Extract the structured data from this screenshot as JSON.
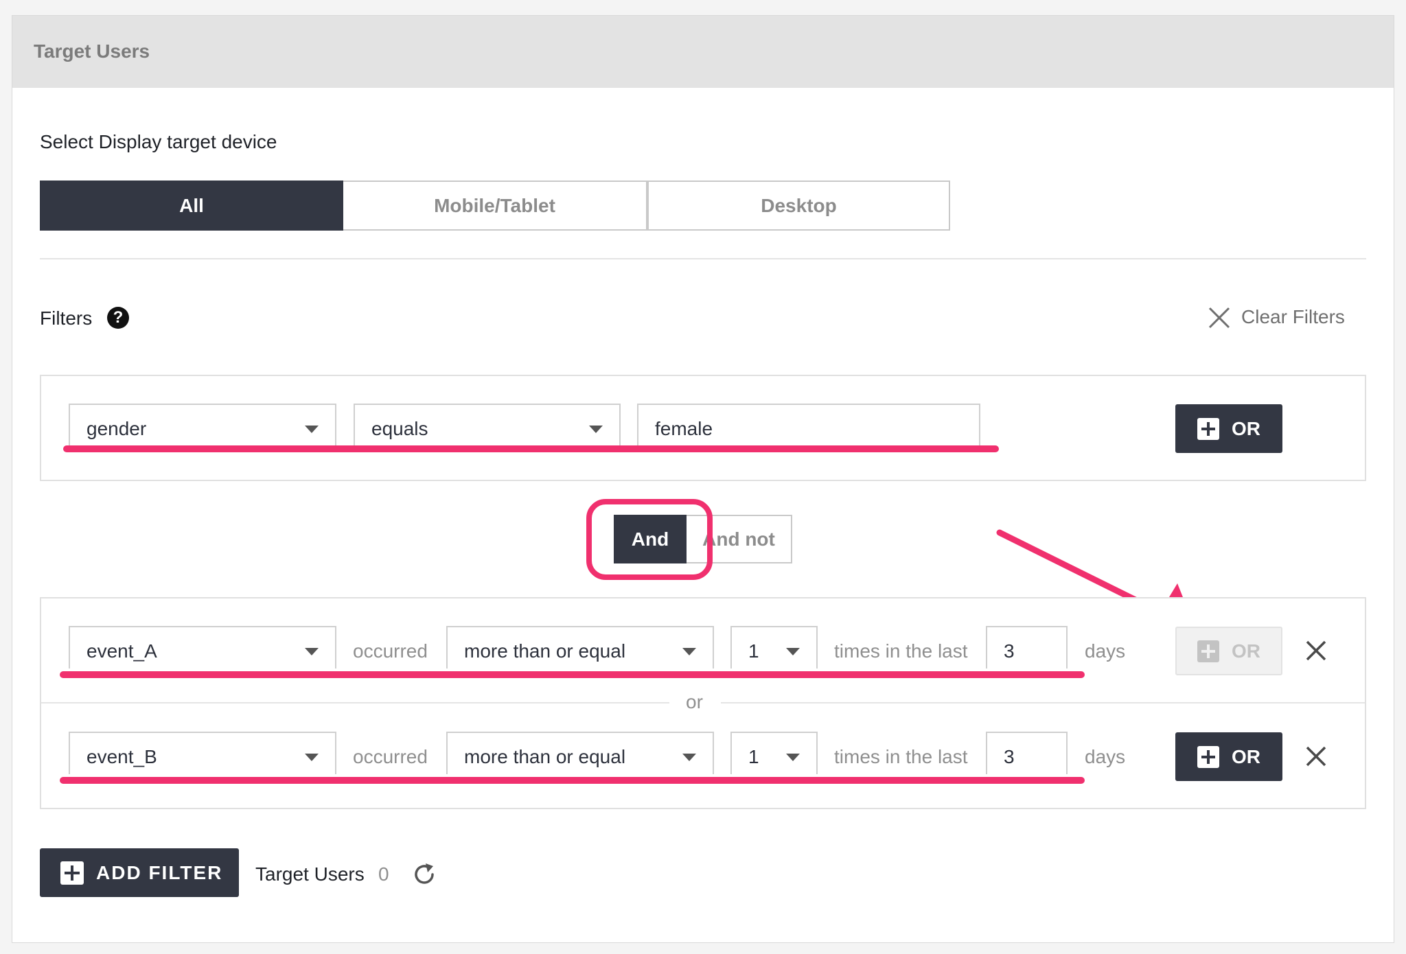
{
  "panel": {
    "title": "Target Users"
  },
  "device": {
    "label": "Select Display target device",
    "options": [
      "All",
      "Mobile/Tablet",
      "Desktop"
    ],
    "selected": "All"
  },
  "filters": {
    "label": "Filters",
    "help_icon": "question-circle-icon",
    "clear_label": "Clear Filters",
    "group1": {
      "field": "gender",
      "operator": "equals",
      "value": "female",
      "or_label": "OR"
    },
    "logic": {
      "and": "And",
      "and_not": "And not",
      "selected": "And"
    },
    "group2": {
      "rows": [
        {
          "event": "event_A",
          "occurred": "occurred",
          "comparator": "more than or equal",
          "count": "1",
          "times_label": "times in the last",
          "days_value": "3",
          "days_label": "days",
          "or_label": "OR",
          "or_enabled": false
        },
        {
          "event": "event_B",
          "occurred": "occurred",
          "comparator": "more than or equal",
          "count": "1",
          "times_label": "times in the last",
          "days_value": "3",
          "days_label": "days",
          "or_label": "OR",
          "or_enabled": true
        }
      ],
      "separator": "or"
    }
  },
  "footer": {
    "add_filter_label": "ADD FILTER",
    "target_users_label": "Target Users",
    "target_users_count": "0",
    "refresh_icon": "refresh-icon"
  },
  "colors": {
    "dark": "#333743",
    "annotation": "#f0306e",
    "header_bg": "#e3e3e3"
  }
}
